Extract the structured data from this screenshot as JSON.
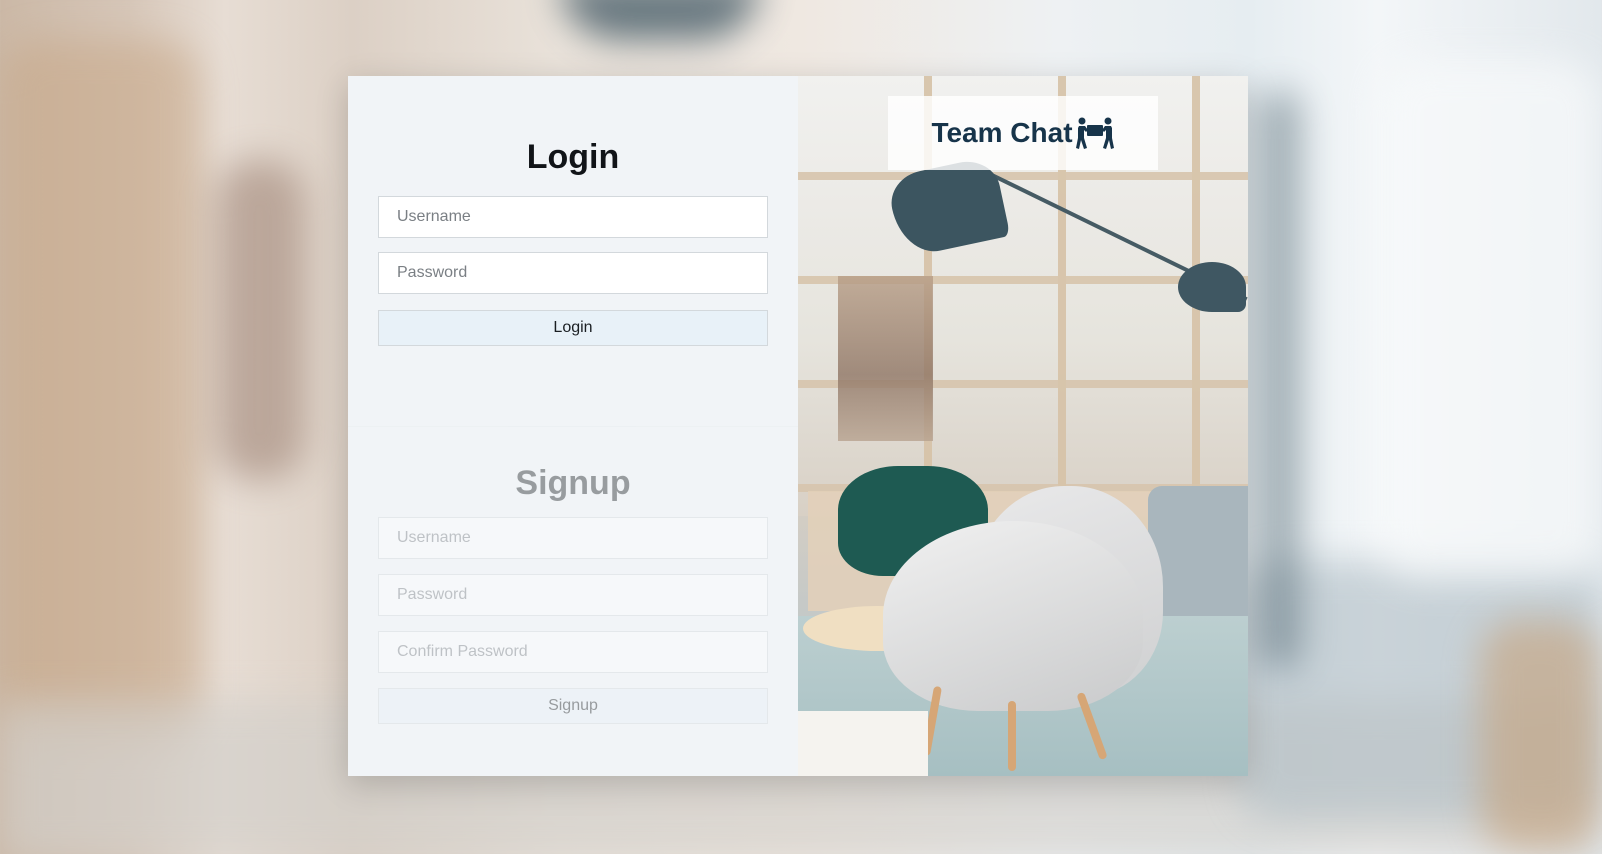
{
  "login": {
    "title": "Login",
    "username_placeholder": "Username",
    "password_placeholder": "Password",
    "button_label": "Login"
  },
  "signup": {
    "title": "Signup",
    "username_placeholder": "Username",
    "password_placeholder": "Password",
    "confirm_password_placeholder": "Confirm Password",
    "button_label": "Signup"
  },
  "brand": {
    "name": "Team Chat",
    "icon": "people-carrying-box-icon"
  },
  "colors": {
    "brand_text": "#17344a",
    "button_bg": "#e8f1f8",
    "form_bg": "#f1f4f7"
  }
}
